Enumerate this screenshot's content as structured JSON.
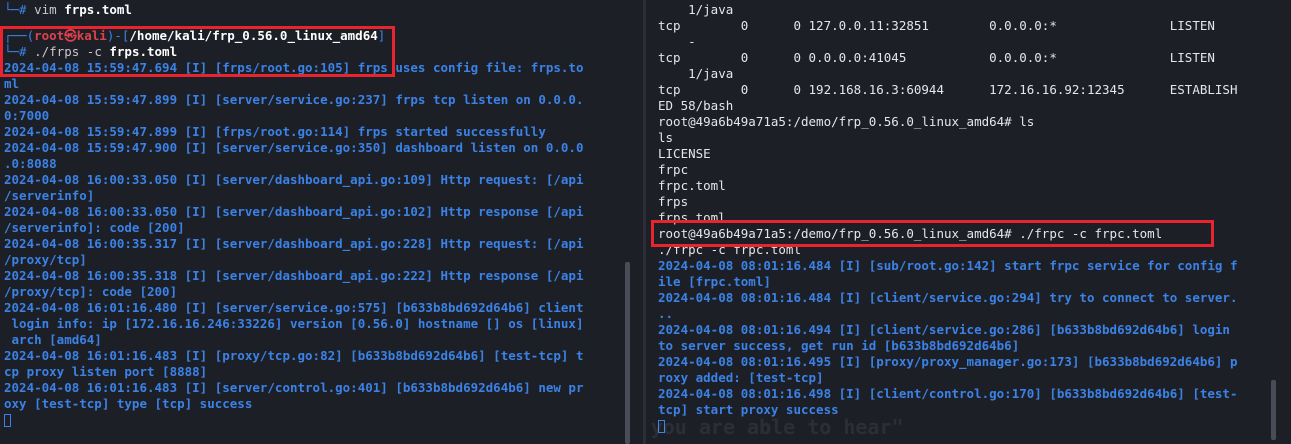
{
  "left": {
    "prev_prompt_prefix": "└─# ",
    "prev_cmd": "vim ",
    "prev_cmd_arg": "frps.toml",
    "prompt": {
      "prefix": "┌──(",
      "user": "root㉿kali",
      "mid": ")-[",
      "path": "/home/kali/frp_0.56.0_linux_amd64",
      "suffix": "]",
      "line2_prefix": "└─# ",
      "cmd": "./frps -c ",
      "cmd_arg": "frps.toml"
    },
    "log_lines": [
      "2024-04-08 15:59:47.694 [I] [frps/root.go:105] frps uses config file: frps.to",
      "ml",
      "2024-04-08 15:59:47.899 [I] [server/service.go:237] frps tcp listen on 0.0.0.",
      "0:7000",
      "2024-04-08 15:59:47.899 [I] [frps/root.go:114] frps started successfully",
      "2024-04-08 15:59:47.900 [I] [server/service.go:350] dashboard listen on 0.0.0",
      ".0:8088",
      "2024-04-08 16:00:33.050 [I] [server/dashboard_api.go:109] Http request: [/api",
      "/serverinfo]",
      "2024-04-08 16:00:33.050 [I] [server/dashboard_api.go:102] Http response [/api",
      "/serverinfo]: code [200]",
      "2024-04-08 16:00:35.317 [I] [server/dashboard_api.go:228] Http request: [/api",
      "/proxy/tcp]",
      "2024-04-08 16:00:35.318 [I] [server/dashboard_api.go:222] Http response [/api",
      "/proxy/tcp]: code [200]",
      "2024-04-08 16:01:16.480 [I] [server/service.go:575] [b633b8bd692d64b6] client",
      " login info: ip [172.16.16.246:33226] version [0.56.0] hostname [] os [linux]",
      " arch [amd64]",
      "2024-04-08 16:01:16.483 [I] [proxy/tcp.go:82] [b633b8bd692d64b6] [test-tcp] t",
      "cp proxy listen port [8888]",
      "2024-04-08 16:01:16.483 [I] [server/control.go:401] [b633b8bd692d64b6] new pr",
      "oxy [test-tcp] type [tcp] success"
    ]
  },
  "right": {
    "netstat_lines": [
      "    1/java",
      "tcp        0      0 127.0.0.11:32851        0.0.0.0:*               LISTEN",
      "    -",
      "tcp        0      0 0.0.0.0:41045           0.0.0.0:*               LISTEN",
      "    1/java",
      "tcp        0      0 192.168.16.3:60944      172.16.16.92:12345      ESTABLISH",
      "ED 58/bash"
    ],
    "ls_prompt": "root@49a6b49a71a5:/demo/frp_0.56.0_linux_amd64# ls",
    "ls_echo": "ls",
    "ls_output": [
      "LICENSE",
      "frpc",
      "frpc.toml",
      "frps",
      "frps.toml"
    ],
    "run_prompt": "root@49a6b49a71a5:/demo/frp_0.56.0_linux_amd64# ./frpc -c frpc.toml",
    "run_echo": "./frpc -c frpc.toml",
    "log_lines": [
      "2024-04-08 08:01:16.484 [I] [sub/root.go:142] start frpc service for config f",
      "ile [frpc.toml]",
      "2024-04-08 08:01:16.484 [I] [client/service.go:294] try to connect to server.",
      "..",
      "2024-04-08 08:01:16.494 [I] [client/service.go:286] [b633b8bd692d64b6] login",
      "to server success, get run id [b633b8bd692d64b6]",
      "2024-04-08 08:01:16.495 [I] [proxy/proxy_manager.go:173] [b633b8bd692d64b6] p",
      "roxy added: [test-tcp]",
      "2024-04-08 08:01:16.498 [I] [client/control.go:170] [b633b8bd692d64b6] [test-",
      "tcp] start proxy success"
    ]
  },
  "watermark": {
    "tagline": "become, the more you are able to hear\""
  },
  "colors": {
    "log_blue": "#3b82e6",
    "highlight_red": "#e8242e",
    "background": "#1d1f27",
    "root_red": "#e0424d"
  }
}
